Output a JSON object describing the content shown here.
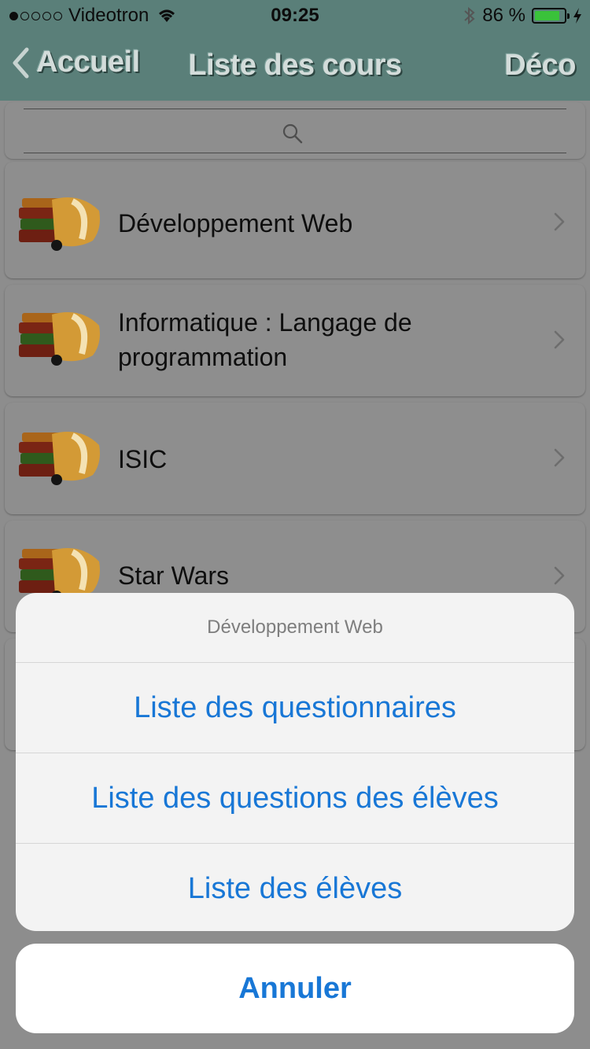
{
  "status": {
    "carrier": "Videotron",
    "time": "09:25",
    "battery": "86 %",
    "battery_level": 0.86
  },
  "nav": {
    "back_label": "Accueil",
    "title": "Liste des cours",
    "action": "Déco"
  },
  "search": {
    "placeholder": ""
  },
  "courses": [
    {
      "label": "Développement Web"
    },
    {
      "label": "Informatique : Langage de programmation"
    },
    {
      "label": "ISIC"
    },
    {
      "label": "Star Wars"
    }
  ],
  "sheet": {
    "title": "Développement Web",
    "options": [
      {
        "label": "Liste des questionnaires"
      },
      {
        "label": "Liste des questions des élèves"
      },
      {
        "label": "Liste des élèves"
      }
    ],
    "cancel": "Annuler"
  },
  "colors": {
    "accent": "#1877d6",
    "nav_bg": "#5a7f79",
    "battery": "#3ac23a"
  }
}
